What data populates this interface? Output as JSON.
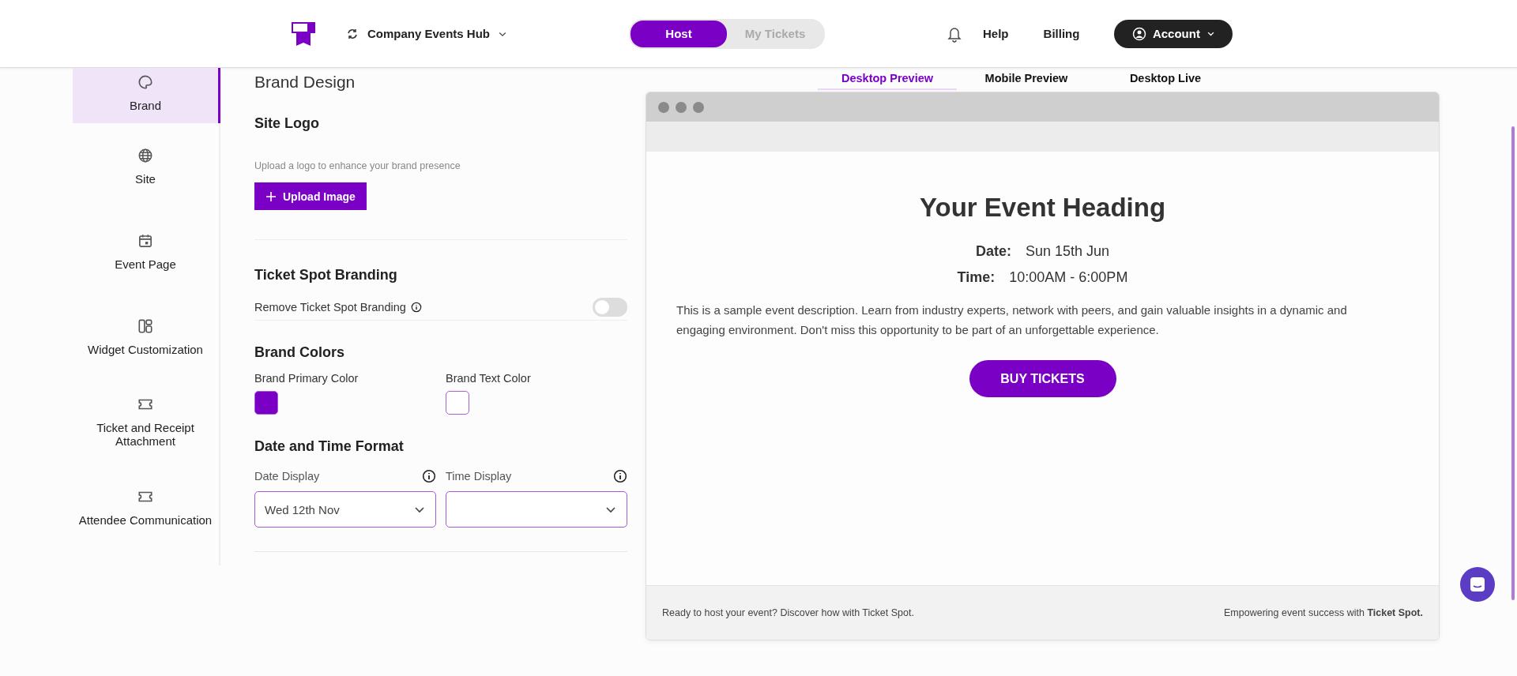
{
  "header": {
    "workspace": "Company Events Hub",
    "mode_tabs": [
      {
        "label": "Host",
        "selected": true
      },
      {
        "label": "My Tickets",
        "selected": false
      }
    ],
    "links": [
      "Help",
      "Billing"
    ],
    "account": "Account"
  },
  "sidebar": {
    "items": [
      {
        "label": "Brand",
        "kind": "palette",
        "selected": true
      },
      {
        "label": "Site",
        "kind": "globe",
        "selected": false
      },
      {
        "label": "Event Page",
        "kind": "calendar",
        "selected": false
      },
      {
        "label": "Widget Customization",
        "kind": "widgets",
        "selected": false
      },
      {
        "label": "Ticket and Receipt Attachment",
        "kind": "ticket",
        "selected": false
      },
      {
        "label": "Attendee Communication",
        "kind": "ticket",
        "selected": false
      }
    ]
  },
  "form": {
    "title": "Brand Design",
    "site_logo": {
      "heading": "Site Logo",
      "hint": "Upload a logo to enhance your brand presence",
      "button": "Upload Image"
    },
    "branding": {
      "heading": "Ticket Spot Branding",
      "label": "Remove Ticket Spot Branding",
      "on": false
    },
    "colors": {
      "heading": "Brand Colors",
      "swatches": [
        {
          "label": "Brand Primary Color",
          "color": "#7a00c6"
        },
        {
          "label": "Brand Text Color",
          "color": "#ffffff"
        }
      ]
    },
    "date_time": {
      "heading": "Date and Time Format",
      "selects": [
        {
          "label": "Date Display",
          "value": "Wed 12th Nov"
        },
        {
          "label": "Time Display"
        }
      ]
    }
  },
  "preview": {
    "tabs": [
      {
        "label": "Desktop Preview",
        "selected": true
      },
      {
        "label": "Mobile Preview",
        "selected": false
      },
      {
        "label": "Desktop Live",
        "selected": false
      }
    ],
    "heading": "Your Event Heading",
    "date_label": "Date:",
    "date_value": "Sun 15th Jun",
    "time_label": "Time:",
    "time_value": "10:00AM - 6:00PM",
    "description": "This is a sample event description. Learn from industry experts, network with peers, and gain valuable insights in a dynamic and engaging environment. Don't miss this opportunity to be part of an unforgettable experience.",
    "button": "BUY TICKETS",
    "footer_left": "Ready to host your event? Discover how with Ticket Spot.",
    "footer_right": "Empowering event success with **Ticket Spot.**"
  }
}
